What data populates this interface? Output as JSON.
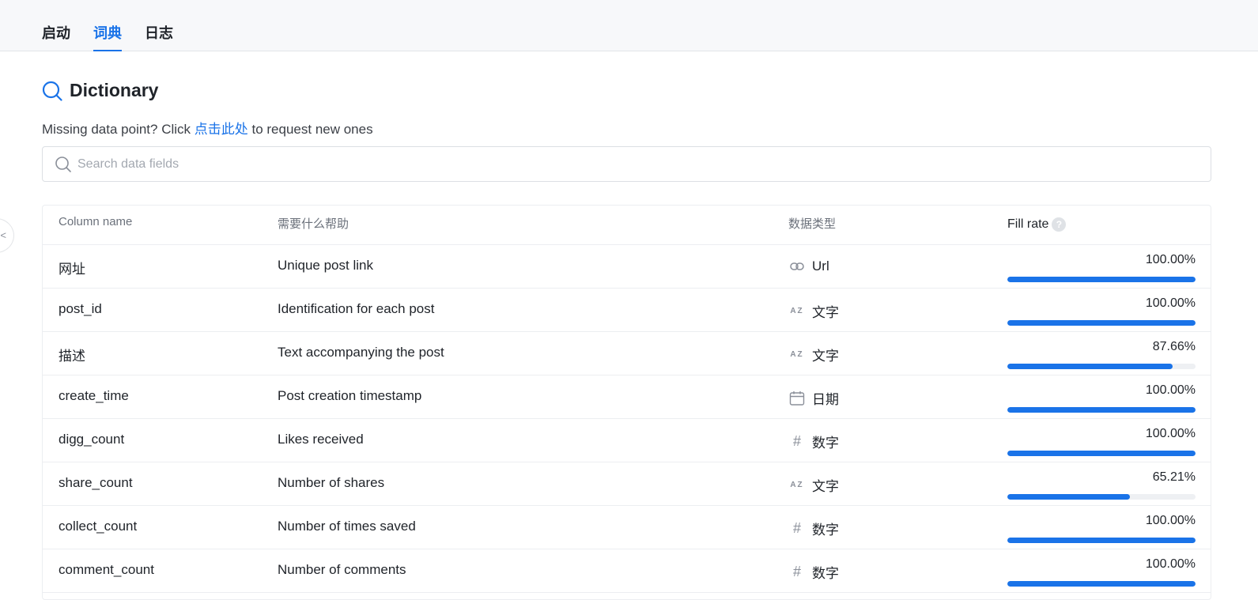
{
  "tabs": [
    {
      "label": "启动",
      "active": false
    },
    {
      "label": "词典",
      "active": true
    },
    {
      "label": "日志",
      "active": false
    }
  ],
  "side_handle": {
    "icon": "chevron-left-icon",
    "glyph": "<"
  },
  "header": {
    "title": "Dictionary",
    "icon": "search-icon",
    "subtitle_prefix": "Missing data point? Click ",
    "subtitle_link": "点击此处",
    "subtitle_suffix": " to request new ones"
  },
  "search": {
    "placeholder": "Search data fields",
    "value": ""
  },
  "table": {
    "columns": [
      "Column name",
      "需要什么帮助",
      "数据类型",
      "Fill rate"
    ],
    "help_glyph": "?",
    "rows": [
      {
        "name": "网址",
        "description": "Unique post link",
        "type": "Url",
        "type_icon": "link-icon",
        "fill_text": "100.00%",
        "fill": 100.0
      },
      {
        "name": "post_id",
        "description": "Identification for each post",
        "type": "文字",
        "type_icon": "text-az-icon",
        "fill_text": "100.00%",
        "fill": 100.0
      },
      {
        "name": "描述",
        "description": "Text accompanying the post",
        "type": "文字",
        "type_icon": "text-az-icon",
        "fill_text": "87.66%",
        "fill": 87.66
      },
      {
        "name": "create_time",
        "description": "Post creation timestamp",
        "type": "日期",
        "type_icon": "calendar-icon",
        "fill_text": "100.00%",
        "fill": 100.0
      },
      {
        "name": "digg_count",
        "description": "Likes received",
        "type": "数字",
        "type_icon": "hash-icon",
        "fill_text": "100.00%",
        "fill": 100.0
      },
      {
        "name": "share_count",
        "description": "Number of shares",
        "type": "文字",
        "type_icon": "text-az-icon",
        "fill_text": "65.21%",
        "fill": 65.21
      },
      {
        "name": "collect_count",
        "description": "Number of times saved",
        "type": "数字",
        "type_icon": "hash-icon",
        "fill_text": "100.00%",
        "fill": 100.0
      },
      {
        "name": "comment_count",
        "description": "Number of comments",
        "type": "数字",
        "type_icon": "hash-icon",
        "fill_text": "100.00%",
        "fill": 100.0
      }
    ]
  },
  "colors": {
    "accent": "#1a73e8",
    "track": "#eef0f3"
  }
}
